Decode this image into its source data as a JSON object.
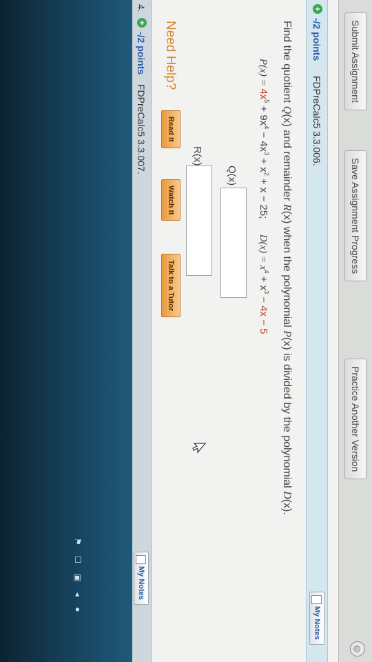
{
  "toolbar": {
    "submit_label": "Submit Assignment",
    "save_label": "Save Assignment Progress",
    "practice_label": "Practice Another Version"
  },
  "question3": {
    "points": "-/2 points",
    "code": "FDPreCalc5 3.3.006.",
    "my_notes": "My Notes",
    "prompt": {
      "t1": "Find the quotient ",
      "q": "Q",
      "t2": "(x) and remainder ",
      "r": "R",
      "t3": "(x) when the polynomial ",
      "p": "P",
      "t4": "(x) is divided by the polynomial ",
      "d": "D",
      "t5": "(x)."
    },
    "formula": {
      "p_lhs": "P(x) = ",
      "p_expr_a": "4x",
      "p_exp5": "5",
      "p_expr_b": " + 9x",
      "p_exp4": "4",
      "p_expr_c": " − 4x",
      "p_exp3": "3",
      "p_expr_d": " + x",
      "p_exp2": "2",
      "p_expr_e": " + x − 25;",
      "d_lhs": "D(x) = x",
      "d_exp4": "4",
      "d_expr_b": " + x",
      "d_exp3": "3",
      "d_expr_c": " − 4x − 5"
    },
    "q_label": "Q(x) =",
    "r_label": "R(x) =",
    "q_value": "",
    "r_value": "",
    "need_help": "Need Help?",
    "read_it": "Read It",
    "watch_it": "Watch It",
    "talk_tutor": "Talk to a Tutor"
  },
  "question4": {
    "number": "4.",
    "points": "-/2 points",
    "code": "FDPreCalc5 3.3.007.",
    "my_notes": "My Notes"
  },
  "icons": {
    "plus": "+",
    "cursor": "cursor-arrow-icon"
  },
  "colors": {
    "points": "#2a5aa8",
    "need_help": "#d6872a",
    "help_button": "#e89a3c",
    "red_coeff": "#c6401f"
  }
}
